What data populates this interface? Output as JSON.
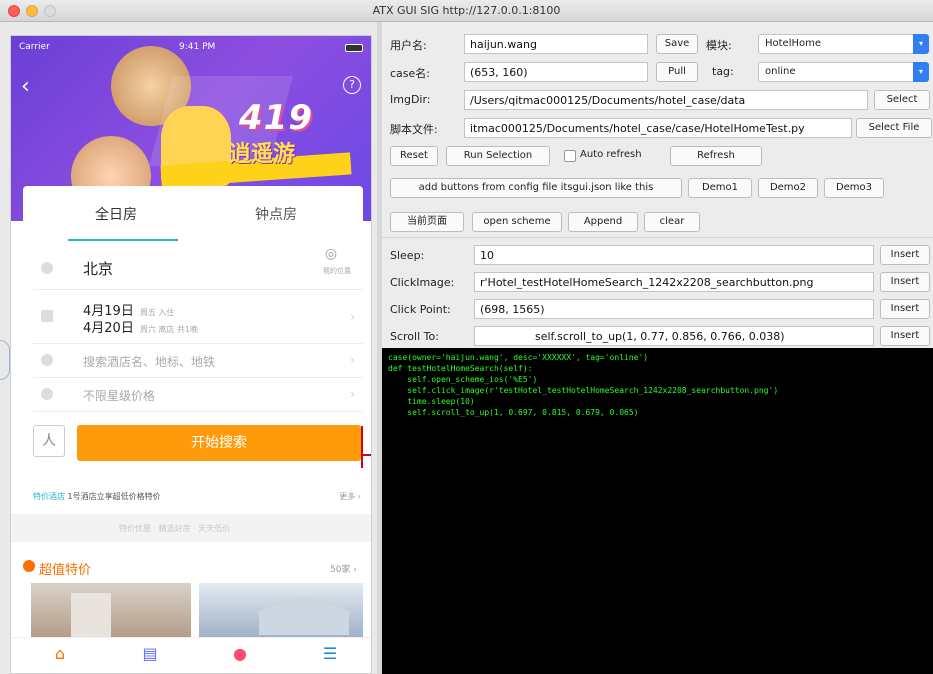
{
  "window": {
    "title": "ATX GUI SIG http://127.0.0.1:8100"
  },
  "phone": {
    "status_left": "Carrier",
    "status_center": "9:41 PM",
    "banner_title": "419",
    "banner_subtitle": "逍遥游",
    "tabs": [
      "全日房",
      "钟点房"
    ],
    "city": "北京",
    "locate_label": "我的位置",
    "checkin": "4月19日",
    "checkin_small": "周五 入住",
    "checkout": "4月20日",
    "checkout_small": "周六 离店 共1晚",
    "keyword_placeholder": "搜索酒店名、地标、地铁",
    "price_placeholder": "不限星级价格",
    "search_button": "开始搜索",
    "notice_highlight": "特价酒店",
    "notice_text": "1号酒店立享超低价格特价",
    "notice_more": "更多 ›",
    "gray_bar_text": "特价优惠 · 精选好房 · 天天低价",
    "special_title": "超值特价",
    "special_more": "50家 ›",
    "nav_icons": [
      "home-icon",
      "orders-icon",
      "location-icon",
      "account-icon"
    ]
  },
  "panel": {
    "username_label": "用户名:",
    "username_value": "haijun.wang",
    "save_button": "Save",
    "module_label": "模块:",
    "module_value": "HotelHome",
    "case_label": "case名:",
    "case_value": "(653, 160)",
    "pull_button": "Pull",
    "tag_label": "tag:",
    "tag_value": "online",
    "imgdir_label": "ImgDir:",
    "imgdir_value": "/Users/qitmac000125/Documents/hotel_case/data",
    "select_button": "Select",
    "script_label": "脚本文件:",
    "script_value": "itmac000125/Documents/hotel_case/case/HotelHomeTest.py",
    "select_file_button": "Select File",
    "reset_button": "Reset",
    "run_selection_button": "Run Selection",
    "auto_refresh_label": "Auto refresh",
    "refresh_button": "Refresh",
    "config_button": "add buttons from config file itsgui.json like this",
    "demo1_button": "Demo1",
    "demo2_button": "Demo2",
    "demo3_button": "Demo3",
    "tool_button": "当前页面",
    "open_scheme_button": "open scheme",
    "append_button": "Append",
    "clear_button": "clear",
    "sleep_label": "Sleep:",
    "sleep_value": "10",
    "clickimage_label": "ClickImage:",
    "clickimage_value": "r'Hotel_testHotelHomeSearch_1242x2208_searchbutton.png",
    "clickpoint_label": "Click Point:",
    "clickpoint_value": "(698, 1565)",
    "scrollto_label": "Scroll To:",
    "scrollto_value": "self.scroll_to_up(1, 0.77, 0.856, 0.766, 0.038)",
    "insert_label": "Insert"
  },
  "console": {
    "lines": [
      "case(owner='haijun.wang', desc='XXXXXX', tag='online')",
      "def testHotelHomeSearch(self):",
      "    self.open_scheme_ios('%E5')",
      "    self.click_image(r'testHotel_testHotelHomeSearch_1242x2208_searchbutton.png')",
      "    time.sleep(10)",
      "    self.scroll_to_up(1, 0.697, 0.815, 0.679, 0.065)"
    ]
  },
  "colors": {
    "console_text": "#2aff2a",
    "console_bg": "#000000",
    "search_orange": "#ff9a0a",
    "tab_accent": "#1fb9c8",
    "select_blue": "#2f7ff1"
  }
}
